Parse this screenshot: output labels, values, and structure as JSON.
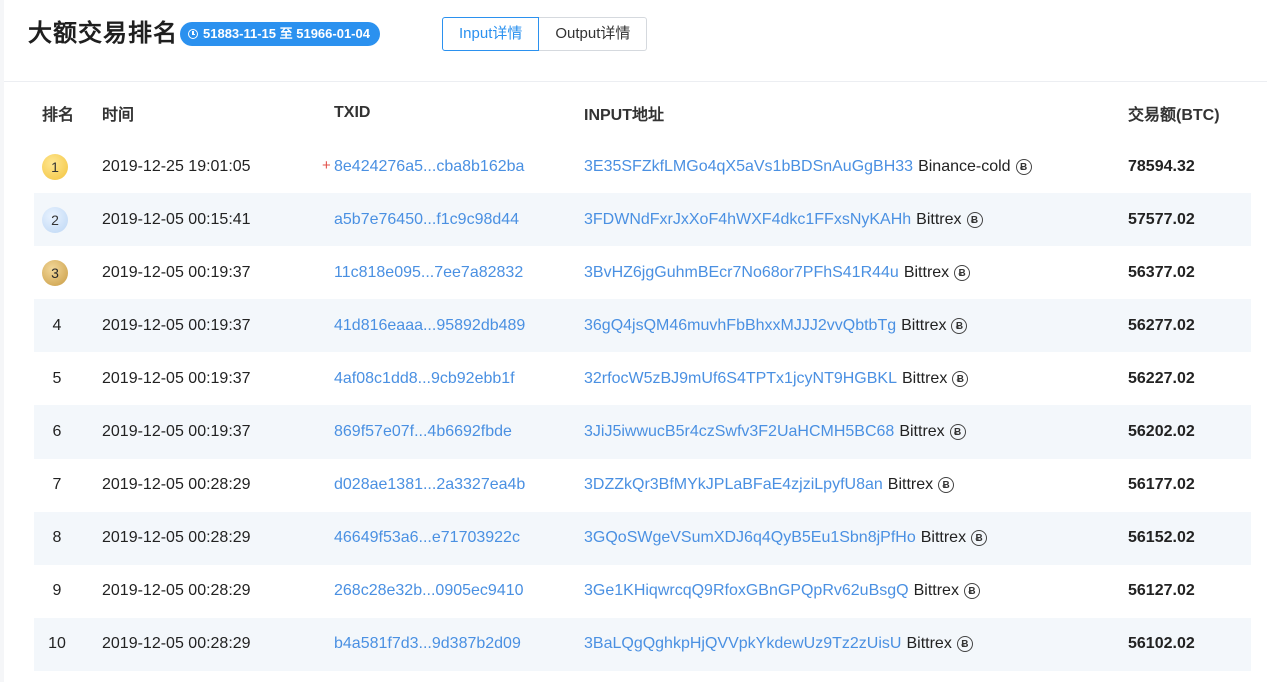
{
  "header": {
    "title": "大额交易排名",
    "date_range": "51883-11-15 至 51966-01-04",
    "tabs": [
      {
        "label": "Input详情",
        "active": true
      },
      {
        "label": "Output详情",
        "active": false
      }
    ]
  },
  "table": {
    "columns": [
      "排名",
      "时间",
      "TXID",
      "INPUT地址",
      "交易额(BTC)"
    ],
    "rows": [
      {
        "rank": "1",
        "time": "2019-12-25 19:01:05",
        "txid": "8e424276a5...cba8b162ba",
        "new": true,
        "address": "3E35SFZkfLMGo4qX5aVs1bBDSnAuGgBH33",
        "tag": "Binance-cold",
        "amount": "78594.32"
      },
      {
        "rank": "2",
        "time": "2019-12-05 00:15:41",
        "txid": "a5b7e76450...f1c9c98d44",
        "new": false,
        "address": "3FDWNdFxrJxXoF4hWXF4dkc1FFxsNyKAHh",
        "tag": "Bittrex",
        "amount": "57577.02"
      },
      {
        "rank": "3",
        "time": "2019-12-05 00:19:37",
        "txid": "11c818e095...7ee7a82832",
        "new": false,
        "address": "3BvHZ6jgGuhmBEcr7No68or7PFhS41R44u",
        "tag": "Bittrex",
        "amount": "56377.02"
      },
      {
        "rank": "4",
        "time": "2019-12-05 00:19:37",
        "txid": "41d816eaaa...95892db489",
        "new": false,
        "address": "36gQ4jsQM46muvhFbBhxxMJJJ2vvQbtbTg",
        "tag": "Bittrex",
        "amount": "56277.02"
      },
      {
        "rank": "5",
        "time": "2019-12-05 00:19:37",
        "txid": "4af08c1dd8...9cb92ebb1f",
        "new": false,
        "address": "32rfocW5zBJ9mUf6S4TPTx1jcyNT9HGBKL",
        "tag": "Bittrex",
        "amount": "56227.02"
      },
      {
        "rank": "6",
        "time": "2019-12-05 00:19:37",
        "txid": "869f57e07f...4b6692fbde",
        "new": false,
        "address": "3JiJ5iwwucB5r4czSwfv3F2UaHCMH5BC68",
        "tag": "Bittrex",
        "amount": "56202.02"
      },
      {
        "rank": "7",
        "time": "2019-12-05 00:28:29",
        "txid": "d028ae1381...2a3327ea4b",
        "new": false,
        "address": "3DZZkQr3BfMYkJPLaBFaE4zjziLpyfU8an",
        "tag": "Bittrex",
        "amount": "56177.02"
      },
      {
        "rank": "8",
        "time": "2019-12-05 00:28:29",
        "txid": "46649f53a6...e71703922c",
        "new": false,
        "address": "3GQoSWgeVSumXDJ6q4QyB5Eu1Sbn8jPfHo",
        "tag": "Bittrex",
        "amount": "56152.02"
      },
      {
        "rank": "9",
        "time": "2019-12-05 00:28:29",
        "txid": "268c28e32b...0905ec9410",
        "new": false,
        "address": "3Ge1KHiqwrcqQ9RfoxGBnGPQpRv62uBsgQ",
        "tag": "Bittrex",
        "amount": "56127.02"
      },
      {
        "rank": "10",
        "time": "2019-12-05 00:28:29",
        "txid": "b4a581f7d3...9d387b2d09",
        "new": false,
        "address": "3BaLQgQghkpHjQVVpkYkdewUz9Tz2zUisU",
        "tag": "Bittrex",
        "amount": "56102.02"
      }
    ]
  },
  "icons": {
    "clock": "clock-icon",
    "bitcoin": "bitcoin-icon",
    "plus": "+"
  },
  "colors": {
    "accent": "#2b91ef",
    "link": "#4a90e2",
    "plus": "#e2514a"
  }
}
